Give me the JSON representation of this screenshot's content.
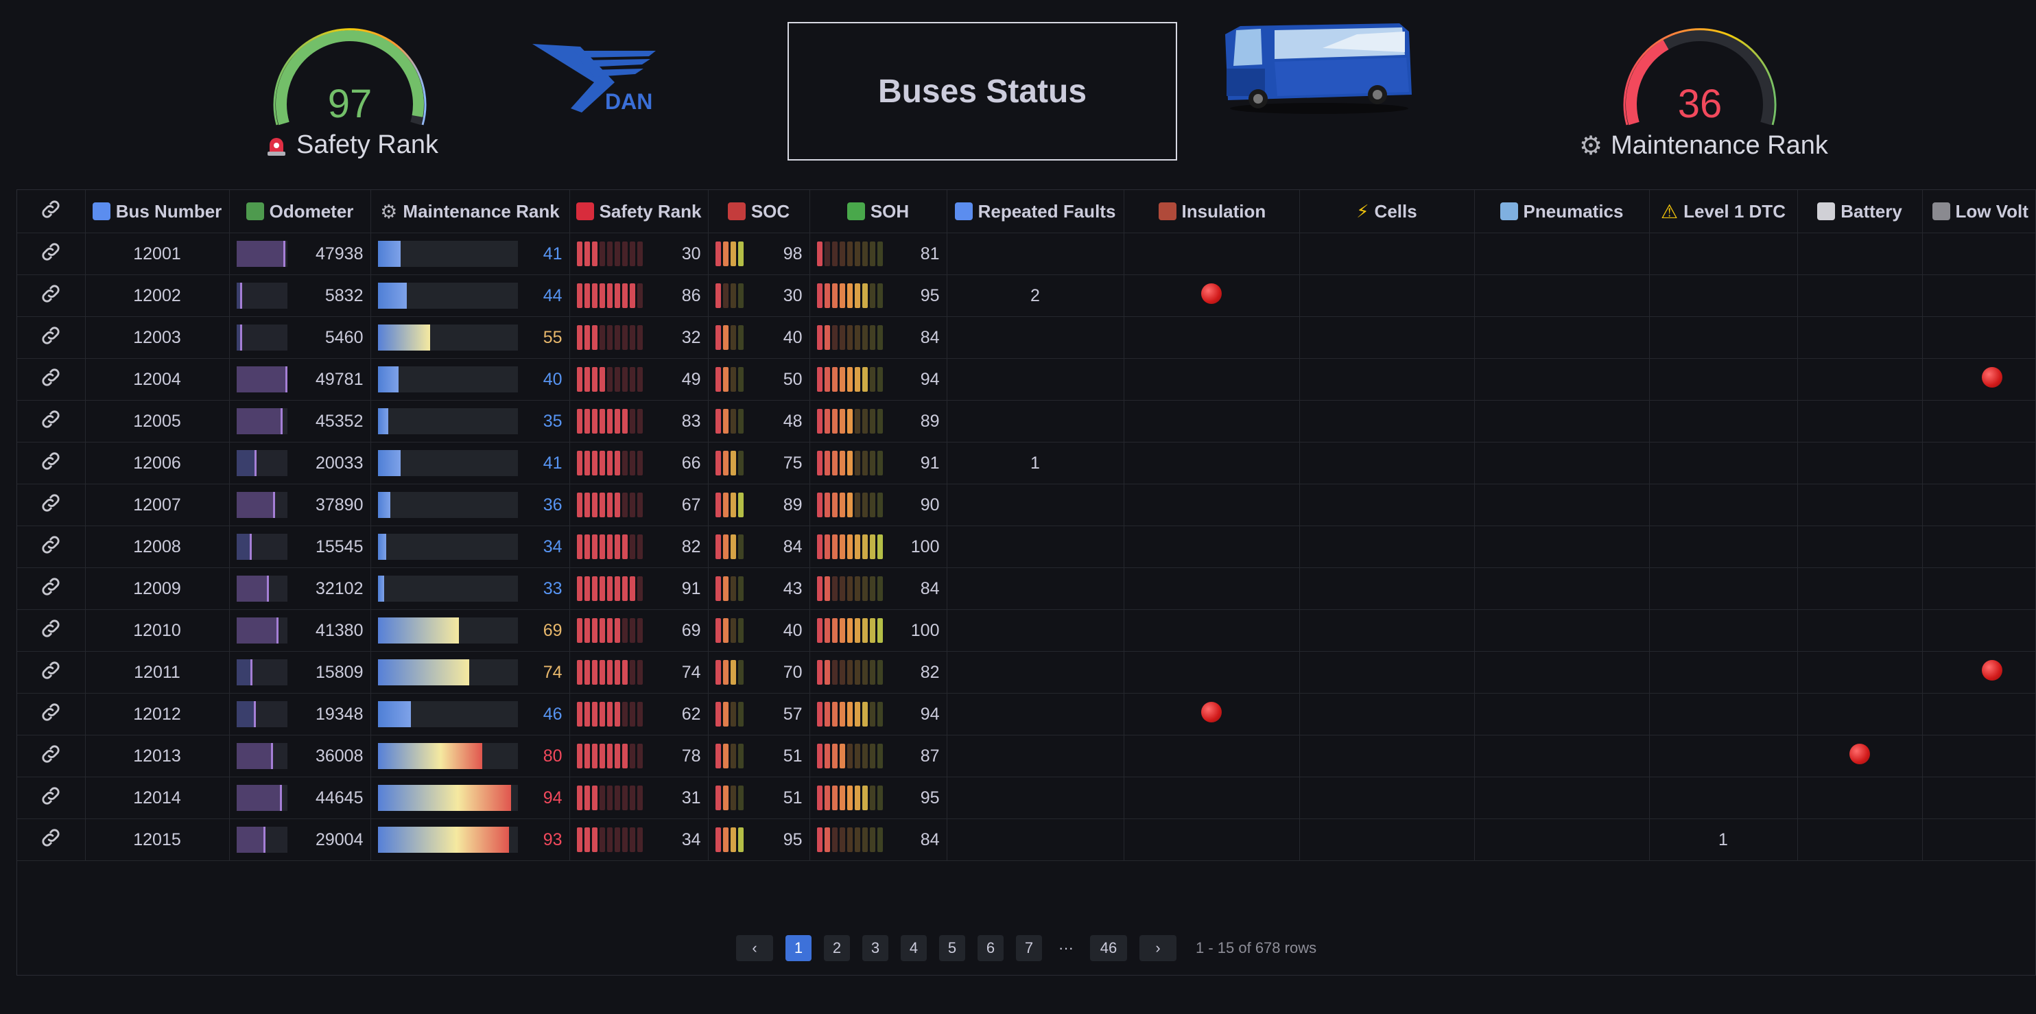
{
  "header": {
    "title": "Buses Status",
    "logo_text": "DAN",
    "safety": {
      "value": "97",
      "label": "Safety Rank",
      "level": 97,
      "color": "#73bf69"
    },
    "maintenance": {
      "value": "36",
      "label": "Maintenance Rank",
      "level": 36,
      "color": "#f2495c"
    }
  },
  "table": {
    "columns": [
      {
        "label": "",
        "icon": "link-icon"
      },
      {
        "label": "Bus Number",
        "icon": "numbers-icon"
      },
      {
        "label": "Odometer",
        "icon": "bus-odometer-icon"
      },
      {
        "label": "Maintenance Rank",
        "icon": "gear-icon"
      },
      {
        "label": "Safety Rank",
        "icon": "siren-icon"
      },
      {
        "label": "SOC",
        "icon": "battery-soc-icon"
      },
      {
        "label": "SOH",
        "icon": "battery-soh-icon"
      },
      {
        "label": "Repeated Faults",
        "icon": "repeat-icon"
      },
      {
        "label": "Insulation",
        "icon": "shield-icon"
      },
      {
        "label": "Cells",
        "icon": "lightning-icon"
      },
      {
        "label": "Pneumatics",
        "icon": "wind-icon"
      },
      {
        "label": "Level 1 DTC",
        "icon": "warning-icon"
      },
      {
        "label": "Battery",
        "icon": "thermometer-icon"
      },
      {
        "label": "Low Volt",
        "icon": "plug-icon"
      }
    ],
    "rows": [
      {
        "bus": "12001",
        "odometer": "47938",
        "odo_level": 0.96,
        "maint": "41",
        "safety": "30",
        "soc": "98",
        "soh": "81",
        "repeated": "",
        "insulation": false,
        "cells": "",
        "pneumatics": "",
        "dtc": "",
        "battery": false,
        "lowvolt": false
      },
      {
        "bus": "12002",
        "odometer": "5832",
        "odo_level": 0.12,
        "maint": "44",
        "safety": "86",
        "soc": "30",
        "soh": "95",
        "repeated": "2",
        "insulation": true,
        "cells": "",
        "pneumatics": "",
        "dtc": "",
        "battery": false,
        "lowvolt": false
      },
      {
        "bus": "12003",
        "odometer": "5460",
        "odo_level": 0.11,
        "maint": "55",
        "safety": "32",
        "soc": "40",
        "soh": "84",
        "repeated": "",
        "insulation": false,
        "cells": "",
        "pneumatics": "",
        "dtc": "",
        "battery": false,
        "lowvolt": false
      },
      {
        "bus": "12004",
        "odometer": "49781",
        "odo_level": 1.0,
        "maint": "40",
        "safety": "49",
        "soc": "50",
        "soh": "94",
        "repeated": "",
        "insulation": false,
        "cells": "",
        "pneumatics": "",
        "dtc": "",
        "battery": false,
        "lowvolt": true
      },
      {
        "bus": "12005",
        "odometer": "45352",
        "odo_level": 0.91,
        "maint": "35",
        "safety": "83",
        "soc": "48",
        "soh": "89",
        "repeated": "",
        "insulation": false,
        "cells": "",
        "pneumatics": "",
        "dtc": "",
        "battery": false,
        "lowvolt": false
      },
      {
        "bus": "12006",
        "odometer": "20033",
        "odo_level": 0.4,
        "maint": "41",
        "safety": "66",
        "soc": "75",
        "soh": "91",
        "repeated": "1",
        "insulation": false,
        "cells": "",
        "pneumatics": "",
        "dtc": "",
        "battery": false,
        "lowvolt": false
      },
      {
        "bus": "12007",
        "odometer": "37890",
        "odo_level": 0.76,
        "maint": "36",
        "safety": "67",
        "soc": "89",
        "soh": "90",
        "repeated": "",
        "insulation": false,
        "cells": "",
        "pneumatics": "",
        "dtc": "",
        "battery": false,
        "lowvolt": false
      },
      {
        "bus": "12008",
        "odometer": "15545",
        "odo_level": 0.31,
        "maint": "34",
        "safety": "82",
        "soc": "84",
        "soh": "100",
        "repeated": "",
        "insulation": false,
        "cells": "",
        "pneumatics": "",
        "dtc": "",
        "battery": false,
        "lowvolt": false
      },
      {
        "bus": "12009",
        "odometer": "32102",
        "odo_level": 0.64,
        "maint": "33",
        "safety": "91",
        "soc": "43",
        "soh": "84",
        "repeated": "",
        "insulation": false,
        "cells": "",
        "pneumatics": "",
        "dtc": "",
        "battery": false,
        "lowvolt": false
      },
      {
        "bus": "12010",
        "odometer": "41380",
        "odo_level": 0.83,
        "maint": "69",
        "safety": "69",
        "soc": "40",
        "soh": "100",
        "repeated": "",
        "insulation": false,
        "cells": "",
        "pneumatics": "",
        "dtc": "",
        "battery": false,
        "lowvolt": false
      },
      {
        "bus": "12011",
        "odometer": "15809",
        "odo_level": 0.32,
        "maint": "74",
        "safety": "74",
        "soc": "70",
        "soh": "82",
        "repeated": "",
        "insulation": false,
        "cells": "",
        "pneumatics": "",
        "dtc": "",
        "battery": false,
        "lowvolt": true
      },
      {
        "bus": "12012",
        "odometer": "19348",
        "odo_level": 0.39,
        "maint": "46",
        "safety": "62",
        "soc": "57",
        "soh": "94",
        "repeated": "",
        "insulation": true,
        "cells": "",
        "pneumatics": "",
        "dtc": "",
        "battery": false,
        "lowvolt": false
      },
      {
        "bus": "12013",
        "odometer": "36008",
        "odo_level": 0.72,
        "maint": "80",
        "safety": "78",
        "soc": "51",
        "soh": "87",
        "repeated": "",
        "insulation": false,
        "cells": "",
        "pneumatics": "",
        "dtc": "",
        "battery": true,
        "lowvolt": false
      },
      {
        "bus": "12014",
        "odometer": "44645",
        "odo_level": 0.9,
        "maint": "94",
        "safety": "31",
        "soc": "51",
        "soh": "95",
        "repeated": "",
        "insulation": false,
        "cells": "",
        "pneumatics": "",
        "dtc": "",
        "battery": false,
        "lowvolt": false
      },
      {
        "bus": "12015",
        "odometer": "29004",
        "odo_level": 0.58,
        "maint": "93",
        "safety": "34",
        "soc": "95",
        "soh": "84",
        "repeated": "",
        "insulation": false,
        "cells": "",
        "pneumatics": "",
        "dtc": "1",
        "battery": false,
        "lowvolt": false
      }
    ]
  },
  "pagination": {
    "prev": "‹",
    "next": "›",
    "pages": [
      "1",
      "2",
      "3",
      "4",
      "5",
      "6",
      "7",
      "···",
      "46"
    ],
    "current": "1",
    "info": "1 - 15 of 678 rows"
  },
  "colors": {
    "background": "#111217",
    "accent": "#3d71d9",
    "alert_red": "#d11a1a",
    "maint_low": "#5794f2",
    "maint_mid": "#e8b86c",
    "maint_high": "#f2495c"
  }
}
